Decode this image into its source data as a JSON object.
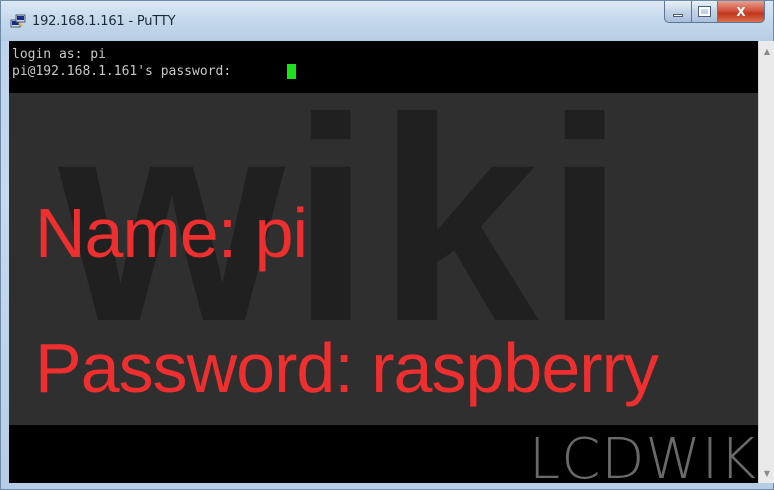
{
  "window": {
    "title": "192.168.1.161 - PuTTY",
    "app_icon": "putty-icon",
    "controls": {
      "minimize": "minimize-icon",
      "maximize": "maximize-icon",
      "close_label": "X"
    }
  },
  "terminal": {
    "lines": [
      "login as: pi",
      "pi@192.168.1.161's password: "
    ],
    "cursor_color": "#1be21b"
  },
  "overlay": {
    "name_line": "Name: pi",
    "password_line": "Password: raspberry",
    "text_color": "#ef2f2f"
  },
  "scrollbar": {
    "up_icon": "scroll-up-arrow-icon",
    "down_icon": "scroll-down-arrow-icon"
  }
}
